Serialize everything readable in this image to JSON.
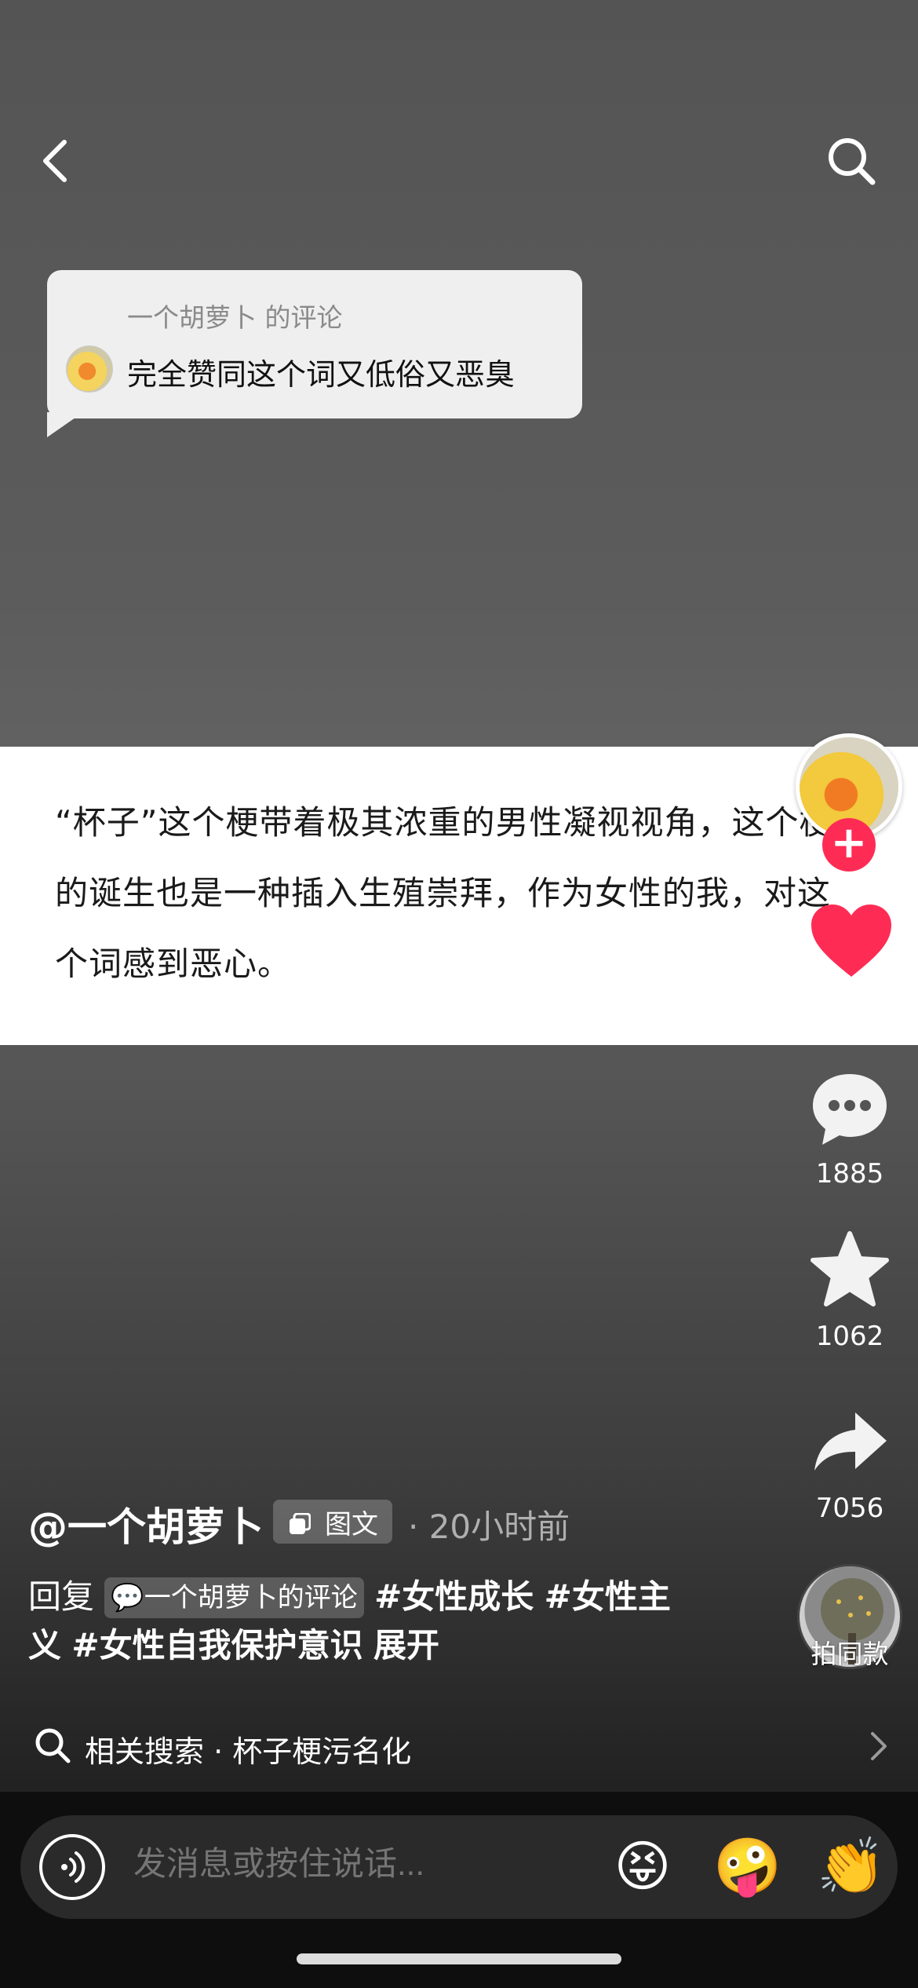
{
  "top_bar": {
    "back_icon": "chevron-left-icon",
    "search_icon": "search-icon"
  },
  "comment_bubble": {
    "meta": "一个胡萝卜 的评论",
    "text": "完全赞同这个词又低俗又恶臭"
  },
  "post": {
    "text": "“杯子”这个梗带着极其浓重的男性凝视视角，这个梗的诞生也是一种插入生殖崇拜，作为女性的我，对这个词感到恶心。"
  },
  "side_actions": {
    "follow_label": "+",
    "like_icon": "heart-icon",
    "comment_count": "1885",
    "favorite_count": "1062",
    "share_count": "7056",
    "music_label": "拍同款",
    "colors": {
      "like": "#fe2c55",
      "follow": "#fe2c55"
    }
  },
  "author": {
    "name": "@一个胡萝卜",
    "type_badge": "图文",
    "time": "· 20小时前"
  },
  "description": {
    "reply_prefix": "回复",
    "reply_chip": "一个胡萝卜的评论",
    "tags": [
      "#女性成长",
      "#女性主义",
      "#女性自我保护意识"
    ],
    "expand": "展开"
  },
  "related_search": {
    "text": "相关搜索 · 杯子梗污名化"
  },
  "bottom_bar": {
    "input_placeholder": "发消息或按住说话...",
    "emojis": [
      "😝",
      "🤪",
      "👏"
    ]
  }
}
